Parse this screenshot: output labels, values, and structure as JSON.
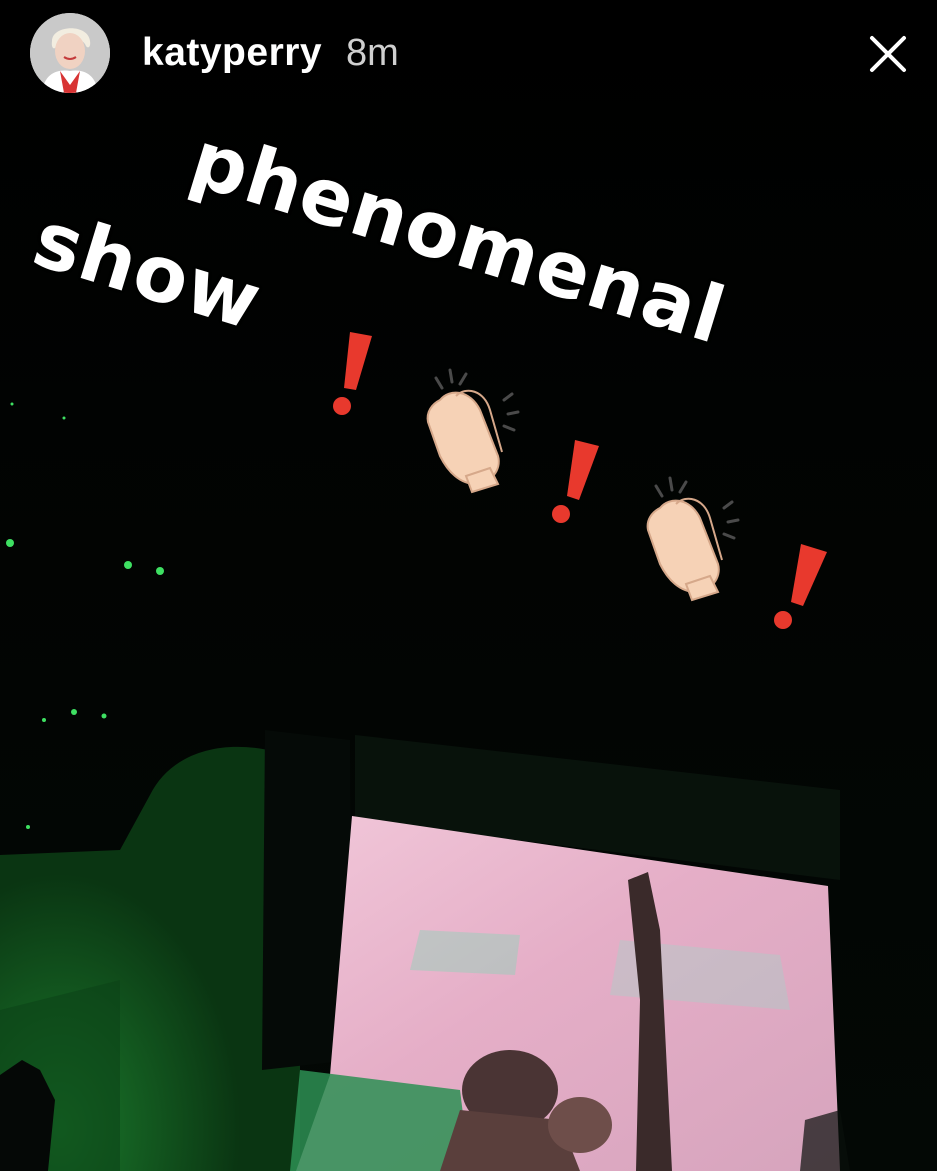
{
  "header": {
    "username": "katyperry",
    "timestamp": "8m"
  },
  "caption": {
    "line1": "phenomenal",
    "line2": "show"
  },
  "stickers": [
    "exclamation-icon",
    "clapping-hands-icon",
    "exclamation-icon",
    "clapping-hands-icon",
    "exclamation-icon"
  ],
  "colors": {
    "caption_text": "#ffffff",
    "exclamation": "#e8392d",
    "stage_green": "#0f5a1e",
    "screen_pink": "#e9b3c8"
  }
}
